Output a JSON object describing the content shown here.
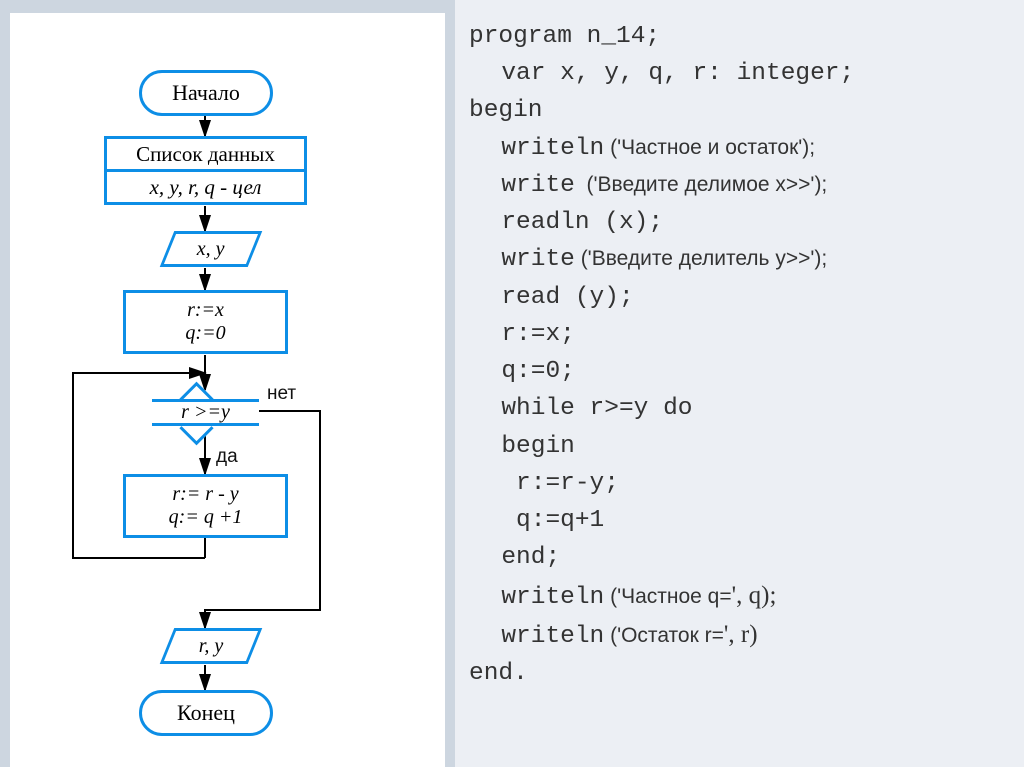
{
  "flow": {
    "start": "Начало",
    "datalist": "Список данных",
    "vars": "x, y, r, q - цел",
    "io1": "x, y",
    "assign1_l1": "r:=x",
    "assign1_l2": "q:=0",
    "cond": "r >=y",
    "no": "нет",
    "yes": "да",
    "loop_l1": "r:= r - y",
    "loop_l2": "q:= q +1",
    "io2": "r, y",
    "end": "Конец"
  },
  "code": {
    "l1a": "program",
    "l1b": " n_14;",
    "l2a": "var",
    "l2b": " x, y, q, r: integer;",
    "l3": "begin",
    "l4a": "writeln",
    "l4b": " ('Частное и остаток');",
    "l5a": "write",
    "l5b": "  ('Введите делимое x>>');",
    "l6": "readln (x);",
    "l7a": "write",
    "l7b": " ('Введите делитель y>>');",
    "l8": "read (y);",
    "l9": "r:=x;",
    "l10": "q:=0;",
    "l11a": "while",
    "l11b": " r>=y ",
    "l11c": "do",
    "l12": "begin",
    "l13": " r:=r-y;",
    "l14": " q:=q+1",
    "l15": "end;",
    "l16a": "writeln",
    "l16b": " ('Частное q=",
    "l16c": "', q);",
    "l17a": "writeln",
    "l17b": " ('Остаток r=",
    "l17c": "', r)",
    "l18": "end."
  }
}
